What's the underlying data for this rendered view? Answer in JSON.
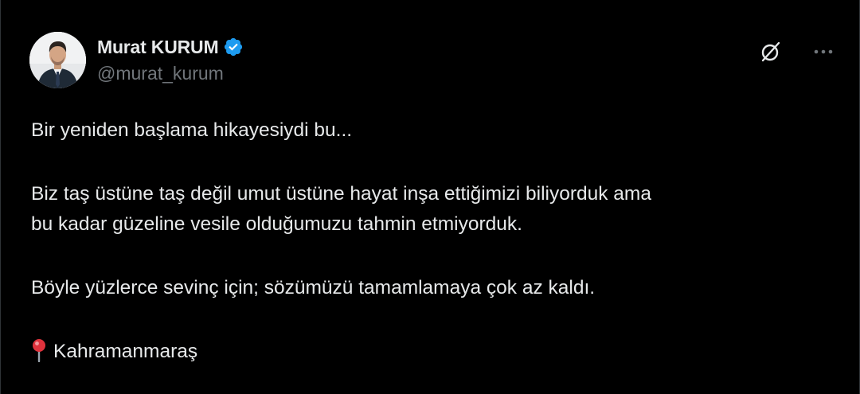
{
  "author": {
    "display_name": "Murat KURUM",
    "handle": "@murat_kurum",
    "verified": true,
    "avatar_icon": "avatar-photo"
  },
  "actions": {
    "grok_icon": "grok-icon",
    "more_icon": "more-icon"
  },
  "post": {
    "paragraphs": [
      "Bir yeniden başlama hikayesiydi bu...",
      "Biz taş üstüne taş değil umut üstüne hayat inşa ettiğimizi biliyorduk ama\nbu kadar güzeline vesile olduğumuzu tahmin etmiyorduk.",
      "Böyle yüzlerce sevinç için; sözümüzü tamamlamaya çok az kaldı."
    ],
    "location_emoji_icon": "round-pushpin-icon",
    "location": "Kahramanmaraş"
  },
  "colors": {
    "background": "#000000",
    "text": "#e7e9ea",
    "secondary_text": "#71767b",
    "verified_badge": "#1d9bf0"
  }
}
